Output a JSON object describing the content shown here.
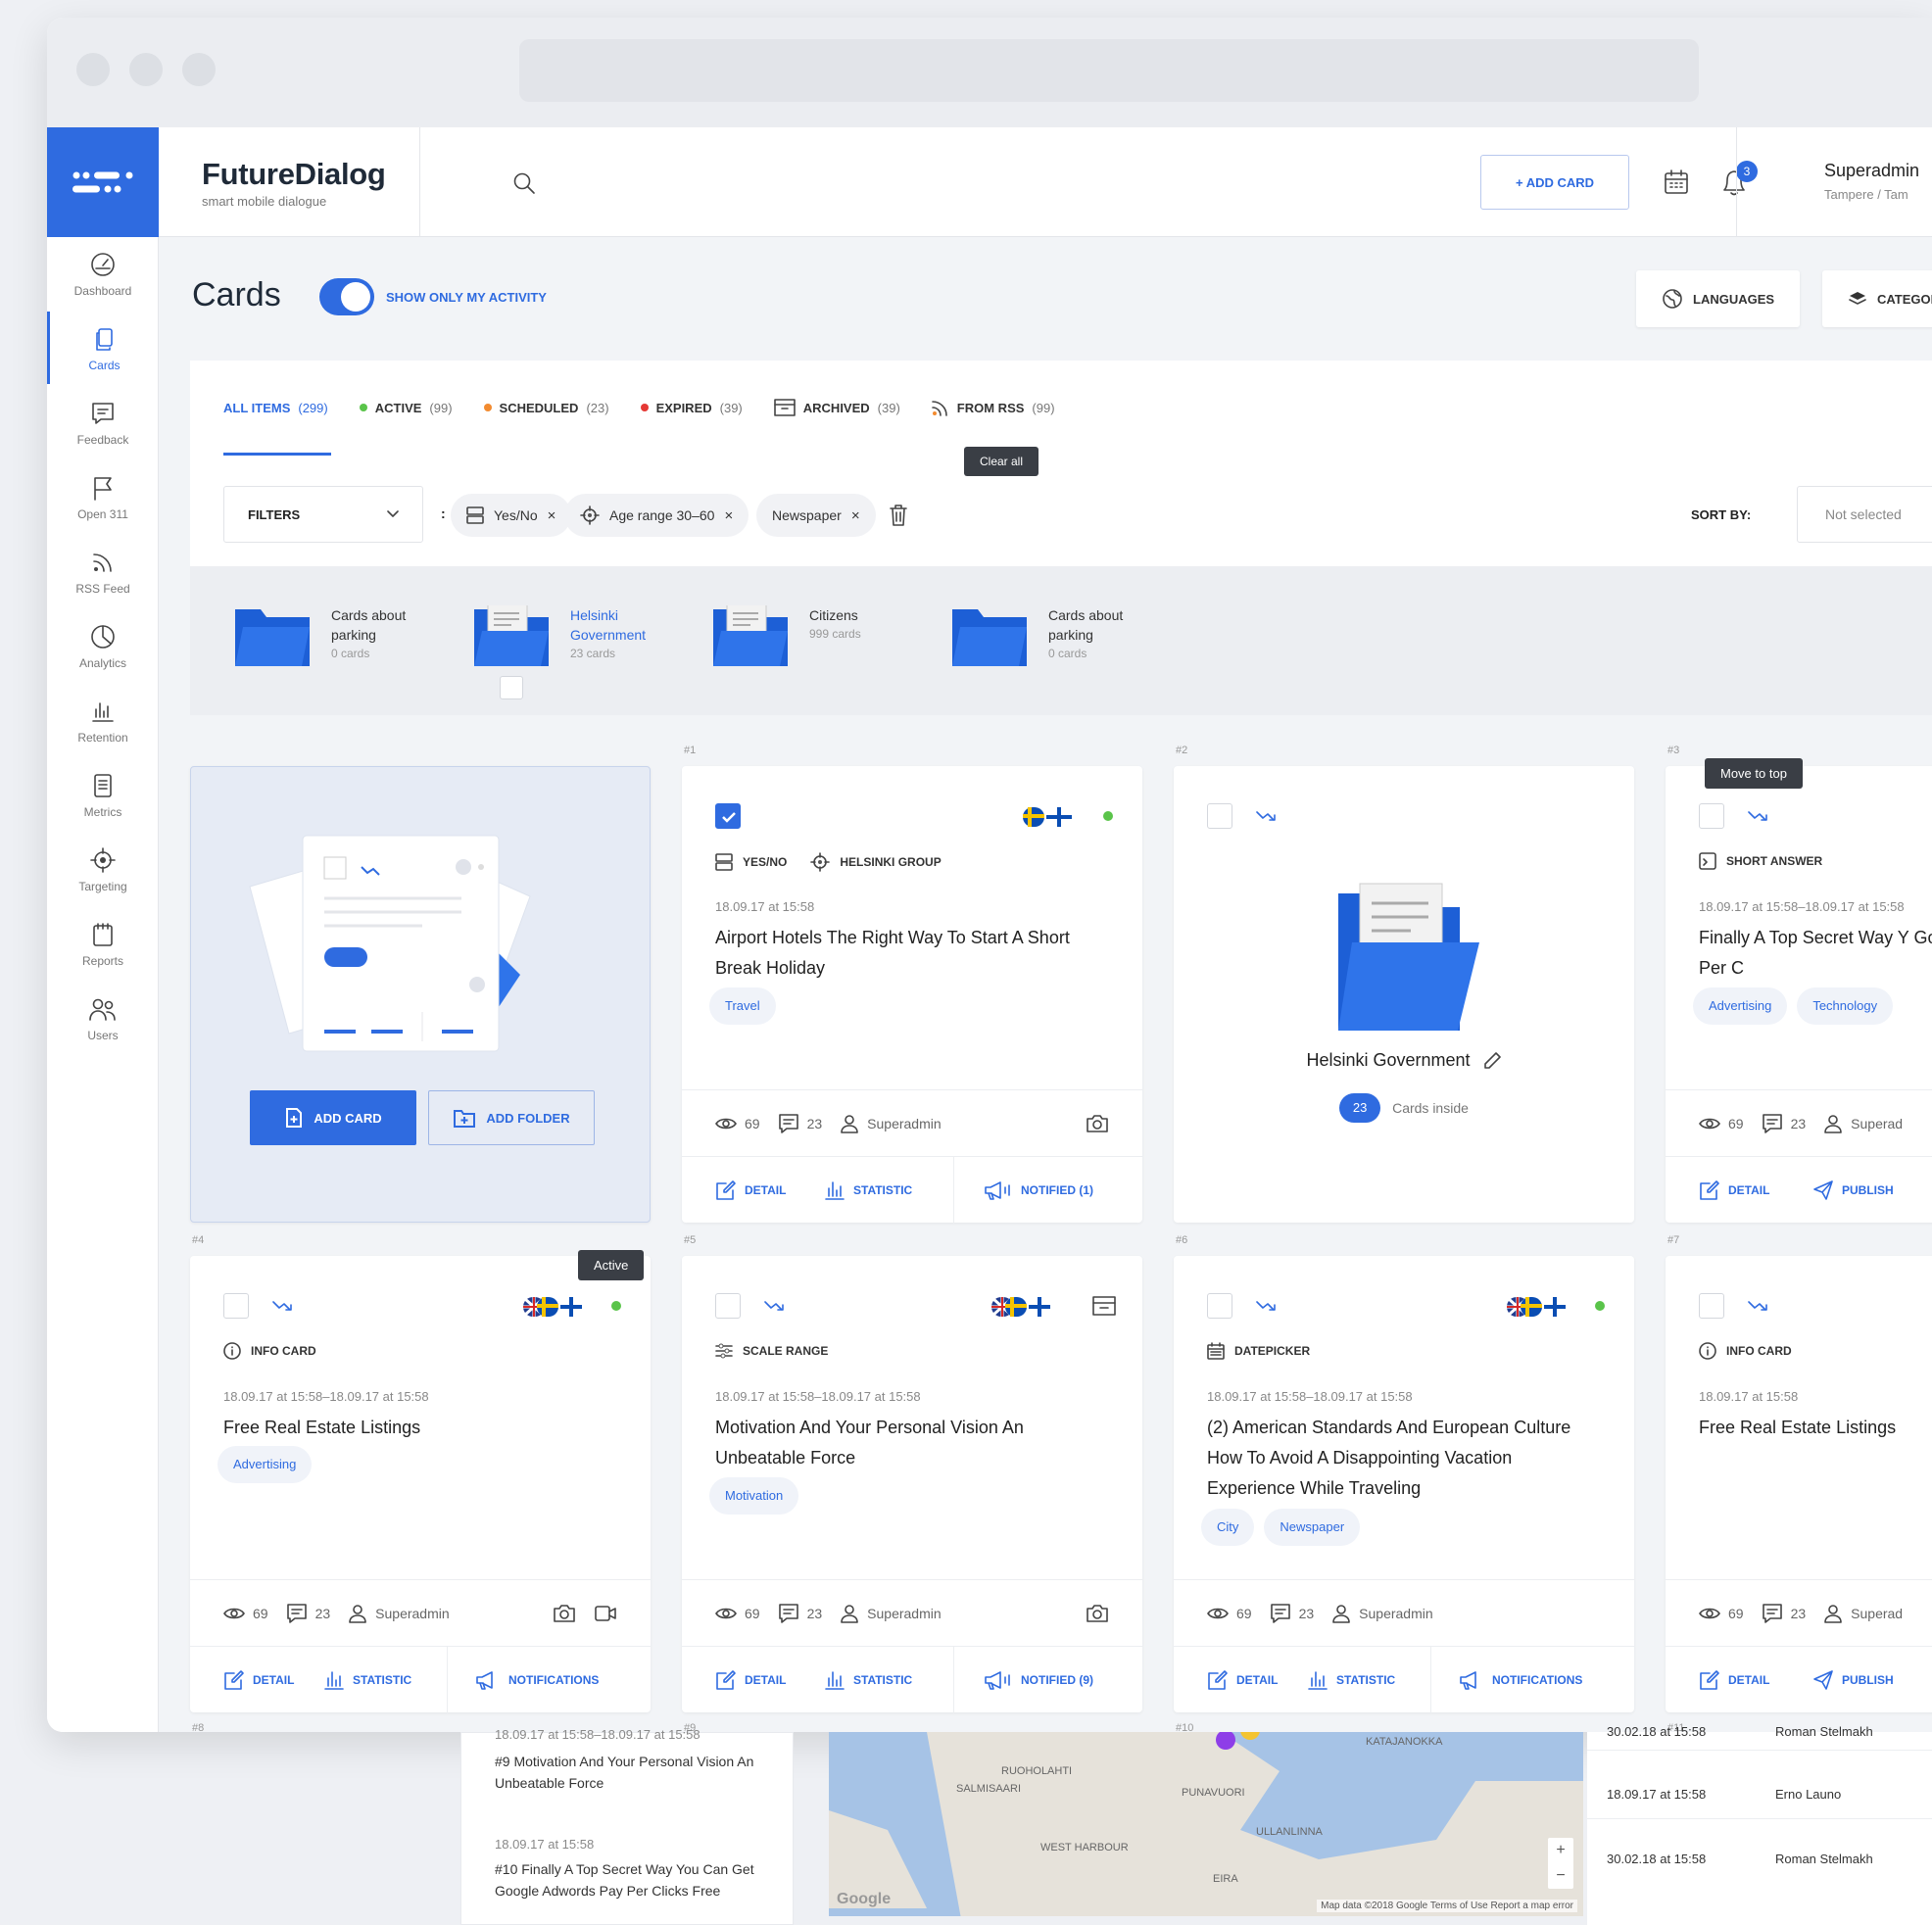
{
  "app": {
    "brand_name": "FutureDialog",
    "brand_tagline": "smart mobile dialogue",
    "add_card_label": "+ ADD CARD",
    "notification_count": "3",
    "user_name": "Superadmin",
    "user_location": "Tampere / Tam"
  },
  "sidebar": {
    "items": [
      {
        "label": "Dashboard",
        "icon": "dashboard-icon"
      },
      {
        "label": "Cards",
        "icon": "cards-icon"
      },
      {
        "label": "Feedback",
        "icon": "feedback-icon"
      },
      {
        "label": "Open 311",
        "icon": "flag-icon"
      },
      {
        "label": "RSS Feed",
        "icon": "rss-icon"
      },
      {
        "label": "Analytics",
        "icon": "analytics-icon"
      },
      {
        "label": "Retention",
        "icon": "bar-chart-icon"
      },
      {
        "label": "Metrics",
        "icon": "metrics-icon"
      },
      {
        "label": "Targeting",
        "icon": "target-icon"
      },
      {
        "label": "Reports",
        "icon": "reports-icon"
      },
      {
        "label": "Users",
        "icon": "users-icon"
      }
    ]
  },
  "page": {
    "title": "Cards",
    "toggle_label": "SHOW ONLY MY ACTIVITY",
    "languages_label": "LANGUAGES",
    "categories_label": "CATEGORIES"
  },
  "tabs": [
    {
      "label": "ALL ITEMS",
      "count": "(299)"
    },
    {
      "label": "ACTIVE",
      "count": "(99)",
      "color": "#5ac44a"
    },
    {
      "label": "SCHEDULED",
      "count": "(23)",
      "color": "#f28b30"
    },
    {
      "label": "EXPIRED",
      "count": "(39)",
      "color": "#e53935"
    },
    {
      "label": "ARCHIVED",
      "count": "(39)"
    },
    {
      "label": "FROM RSS",
      "count": "(99)",
      "color": "#f28b30"
    }
  ],
  "filters": {
    "label": "FILTERS",
    "colon": ":",
    "chips": [
      "Yes/No",
      "Age range 30–60",
      "Newspaper"
    ],
    "chip_close": "×",
    "clear_all_tooltip": "Clear all",
    "sort_by_label": "SORT BY:",
    "sort_value": "Not selected"
  },
  "folders": [
    {
      "title_line1": "Cards about",
      "title_line2": "parking",
      "count": "0 cards"
    },
    {
      "title_line1": "Helsinki",
      "title_line2": "Government",
      "count": "23 cards"
    },
    {
      "title_line1": "Citizens",
      "title_line2": "",
      "count": "999 cards"
    },
    {
      "title_line1": "Cards about",
      "title_line2": "parking",
      "count": "0 cards"
    }
  ],
  "new_card": {
    "add_card": "ADD CARD",
    "add_folder": "ADD FOLDER"
  },
  "card_numbers": [
    "#1",
    "#2",
    "#3",
    "#4",
    "#5",
    "#6",
    "#7",
    "#8",
    "#9",
    "#10",
    "#11"
  ],
  "cards": [
    {
      "type": "YES/NO",
      "group": "HELSINKI GROUP",
      "date": "18.09.17 at 15:58",
      "title": "Airport Hotels The Right Way To Start A Short Break Holiday",
      "tags": [
        "Travel"
      ],
      "views": "69",
      "comments": "23",
      "author": "Superadmin",
      "actions": [
        "DETAIL",
        "STATISTIC",
        "NOTIFIED (1)"
      ]
    },
    {
      "folder_name": "Helsinki Government",
      "cards_inside_count": "23",
      "cards_inside_label": "Cards inside"
    },
    {
      "tooltip": "Move to top",
      "type": "SHORT ANSWER",
      "date": "18.09.17 at 15:58–18.09.17 at 15:58",
      "title": "Finally A Top Secret Way Y Google Adwords Pay Per C",
      "tags": [
        "Advertising",
        "Technology"
      ],
      "views": "69",
      "comments": "23",
      "author": "Superad",
      "actions": [
        "DETAIL",
        "PUBLISH"
      ]
    },
    {
      "tooltip": "Active",
      "type": "INFO CARD",
      "date": "18.09.17 at 15:58–18.09.17 at 15:58",
      "title": "Free Real Estate Listings",
      "tags": [
        "Advertising"
      ],
      "views": "69",
      "comments": "23",
      "author": "Superadmin",
      "actions": [
        "DETAIL",
        "STATISTIC",
        "NOTIFICATIONS"
      ]
    },
    {
      "type": "SCALE RANGE",
      "date": "18.09.17 at 15:58–18.09.17 at 15:58",
      "title": "Motivation And Your Personal Vision An Unbeatable Force",
      "tags": [
        "Motivation"
      ],
      "views": "69",
      "comments": "23",
      "author": "Superadmin",
      "actions": [
        "DETAIL",
        "STATISTIC",
        "NOTIFIED (9)"
      ]
    },
    {
      "type": "DATEPICKER",
      "date": "18.09.17 at 15:58–18.09.17 at 15:58",
      "title": "(2) American Standards And European Culture How To Avoid A Disappointing Vacation Experience While Traveling",
      "tags": [
        "City",
        "Newspaper"
      ],
      "views": "69",
      "comments": "23",
      "author": "Superadmin",
      "actions": [
        "DETAIL",
        "STATISTIC",
        "NOTIFICATIONS"
      ]
    },
    {
      "type": "INFO CARD",
      "date": "18.09.17 at 15:58",
      "title": "Free Real Estate Listings",
      "tags": [],
      "views": "69",
      "comments": "23",
      "author": "Superad",
      "actions": [
        "DETAIL",
        "PUBLISH"
      ]
    }
  ],
  "below": {
    "list_items": [
      {
        "date": "18.09.17 at 15:58–18.09.17 at 15:58",
        "title": "#9 Motivation And Your Personal Vision An Unbeatable Force"
      },
      {
        "date": "18.09.17 at 15:58",
        "title": "#10 Finally A Top Secret Way You Can Get Google Adwords Pay Per Clicks Free"
      }
    ],
    "map_labels": [
      "KATAJANOKKA",
      "RUOHOLAHTI",
      "SALMISAARI",
      "PUNAVUORI",
      "ULLANLINNA",
      "WEST HARBOUR",
      "EIRA"
    ],
    "map_footer": "Map data ©2018 Google   Terms of Use   Report a map error",
    "map_logo": "Google",
    "table_rows": [
      {
        "date": "30.02.18 at 15:58",
        "name": "Roman Stelmakh"
      },
      {
        "date": "18.09.17 at 15:58",
        "name": "Erno Launo"
      },
      {
        "date": "30.02.18 at 15:58",
        "name": "Roman Stelmakh"
      }
    ]
  }
}
